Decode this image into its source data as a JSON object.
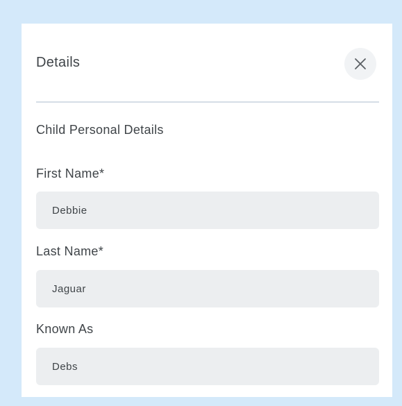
{
  "header": {
    "title": "Details",
    "close_icon": "close-icon"
  },
  "section": {
    "title": "Child Personal Details"
  },
  "fields": {
    "first_name": {
      "label": "First Name*",
      "value": "Debbie"
    },
    "last_name": {
      "label": "Last Name*",
      "value": "Jaguar"
    },
    "known_as": {
      "label": "Known As",
      "value": "Debs"
    }
  },
  "colors": {
    "background": "#d4e9fa",
    "panel": "#ffffff",
    "input_bg": "#eceef0",
    "divider": "#d5dde6",
    "text": "#3f4448"
  }
}
